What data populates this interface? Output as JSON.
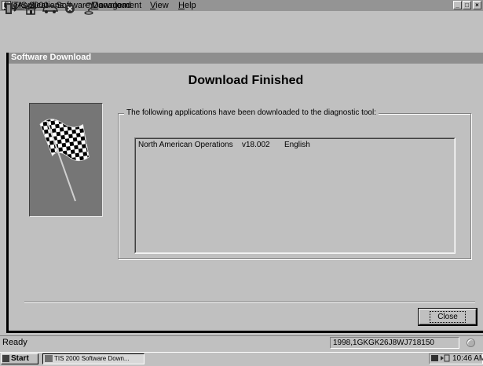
{
  "window": {
    "title": "TIS 2000 - Software Download",
    "controls": [
      "_",
      "□",
      "×"
    ]
  },
  "menu": [
    {
      "label": "File"
    },
    {
      "label": "Applications"
    },
    {
      "label": "Management"
    },
    {
      "label": "View"
    },
    {
      "label": "Help"
    }
  ],
  "toolbar": {
    "icons": [
      "exit-icon",
      "home-icon",
      "vehicle-icon",
      "stop-icon",
      "help-icon"
    ]
  },
  "panel": {
    "title": "Software Download",
    "heading": "Download Finished",
    "group_caption": "The following applications have been downloaded to the diagnostic tool:",
    "applications": [
      {
        "name": "North American Operations",
        "version": "v18.002",
        "language": "English"
      }
    ],
    "close_label": "Close"
  },
  "status": {
    "text": "Ready",
    "vehicle": "1998,1GKGK26J8WJ718150"
  },
  "taskbar": {
    "start_label": "Start",
    "task_label": "TIS 2000 Software Down...",
    "time": "10:46 AM"
  }
}
